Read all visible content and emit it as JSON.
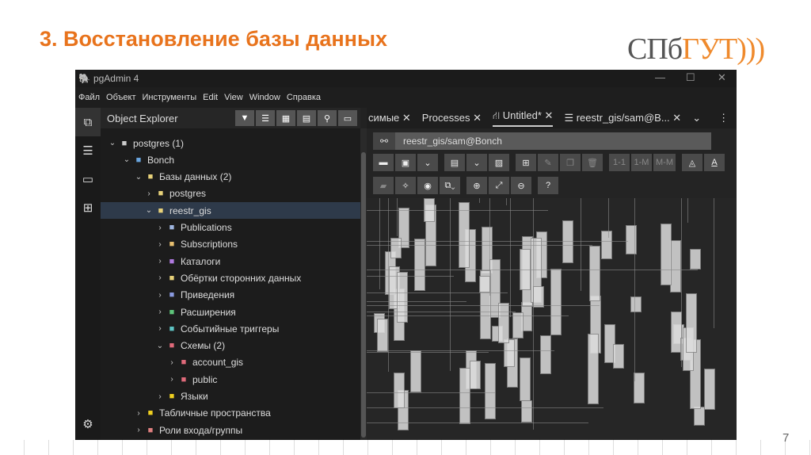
{
  "slide": {
    "title": "3. Восстановление базы данных",
    "logo_left": "СПб",
    "logo_right": "ГУТ)))",
    "page_number": "7"
  },
  "window": {
    "title": "pgAdmin 4",
    "controls": [
      "—",
      "☐",
      "✕"
    ]
  },
  "menu": [
    "Файл",
    "Объект",
    "Инструменты",
    "Edit",
    "View",
    "Window",
    "Справка"
  ],
  "explorer": {
    "title": "Object Explorer",
    "tree": [
      {
        "label": "postgres (1)",
        "level": 0,
        "expanded": true,
        "icon": "server-group-icon"
      },
      {
        "label": "Bonch",
        "level": 1,
        "expanded": true,
        "icon": "server-icon"
      },
      {
        "label": "Базы данных (2)",
        "level": 2,
        "expanded": true,
        "icon": "databases-icon"
      },
      {
        "label": "postgres",
        "level": 3,
        "expanded": false,
        "icon": "database-icon"
      },
      {
        "label": "reestr_gis",
        "level": 3,
        "expanded": true,
        "icon": "database-icon",
        "selected": true
      },
      {
        "label": "Publications",
        "level": 4,
        "expanded": false,
        "icon": "publication-icon"
      },
      {
        "label": "Subscriptions",
        "level": 4,
        "expanded": false,
        "icon": "subscription-icon"
      },
      {
        "label": "Каталоги",
        "level": 4,
        "expanded": false,
        "icon": "catalog-icon"
      },
      {
        "label": "Обёртки сторонних данных",
        "level": 4,
        "expanded": false,
        "icon": "fdw-icon"
      },
      {
        "label": "Приведения",
        "level": 4,
        "expanded": false,
        "icon": "cast-icon"
      },
      {
        "label": "Расширения",
        "level": 4,
        "expanded": false,
        "icon": "extension-icon"
      },
      {
        "label": "Событийные триггеры",
        "level": 4,
        "expanded": false,
        "icon": "event-trigger-icon"
      },
      {
        "label": "Схемы (2)",
        "level": 4,
        "expanded": true,
        "icon": "schemas-icon"
      },
      {
        "label": "account_gis",
        "level": 5,
        "expanded": false,
        "icon": "schema-icon"
      },
      {
        "label": "public",
        "level": 5,
        "expanded": false,
        "icon": "schema-icon"
      },
      {
        "label": "Языки",
        "level": 4,
        "expanded": false,
        "icon": "language-icon"
      },
      {
        "label": "Табличные пространства",
        "level": 2,
        "expanded": false,
        "icon": "tablespace-icon"
      },
      {
        "label": "Роли входа/группы",
        "level": 2,
        "expanded": false,
        "icon": "roles-icon"
      }
    ]
  },
  "tabs": [
    {
      "label": "симые",
      "active": false
    },
    {
      "label": "Processes",
      "active": false
    },
    {
      "label": "Untitled*",
      "active": true
    },
    {
      "label": "reestr_gis/sam@B...",
      "active": false
    }
  ],
  "connection": "reestr_gis/sam@Bonch",
  "toolbar": {
    "rel_1_1": "1-1",
    "rel_1_m": "1-M",
    "rel_m_m": "M-M",
    "text_color": "A"
  }
}
